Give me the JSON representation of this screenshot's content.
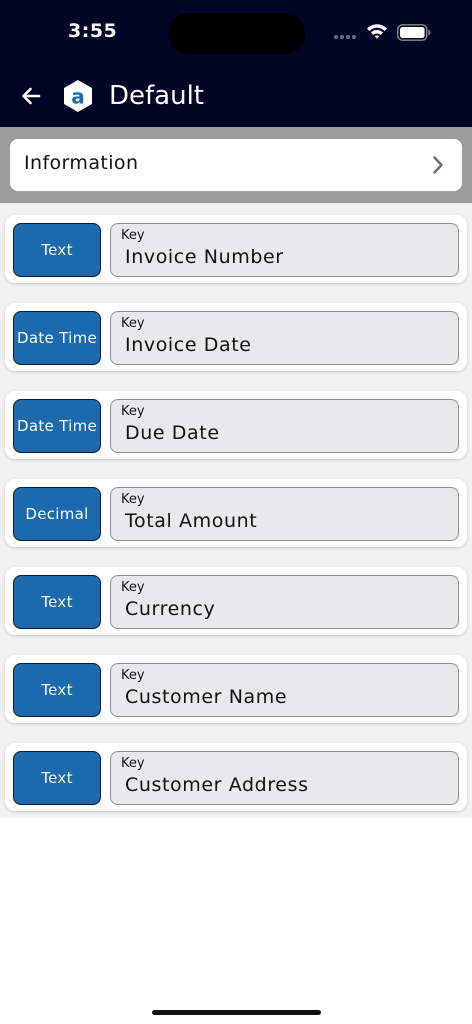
{
  "status_bar": {
    "time": "3:55"
  },
  "header": {
    "title": "Default",
    "logo_letter": "a",
    "colors": {
      "background": "#010626",
      "logo": "#1a6aad"
    }
  },
  "info": {
    "label": "Information"
  },
  "fields": [
    {
      "type": "Text",
      "key_label": "Key",
      "key_value": "Invoice Number"
    },
    {
      "type": "Date Time",
      "key_label": "Key",
      "key_value": "Invoice Date"
    },
    {
      "type": "Date Time",
      "key_label": "Key",
      "key_value": "Due Date"
    },
    {
      "type": "Decimal",
      "key_label": "Key",
      "key_value": "Total Amount"
    },
    {
      "type": "Text",
      "key_label": "Key",
      "key_value": "Currency"
    },
    {
      "type": "Text",
      "key_label": "Key",
      "key_value": "Customer Name"
    },
    {
      "type": "Text",
      "key_label": "Key",
      "key_value": "Customer Address"
    }
  ],
  "icons": {
    "back": "back-arrow-icon",
    "logo": "hexagon-logo-icon",
    "chevron": "chevron-right-icon",
    "wifi": "wifi-icon",
    "battery": "battery-icon",
    "signal": "cellular-signal-icon"
  }
}
